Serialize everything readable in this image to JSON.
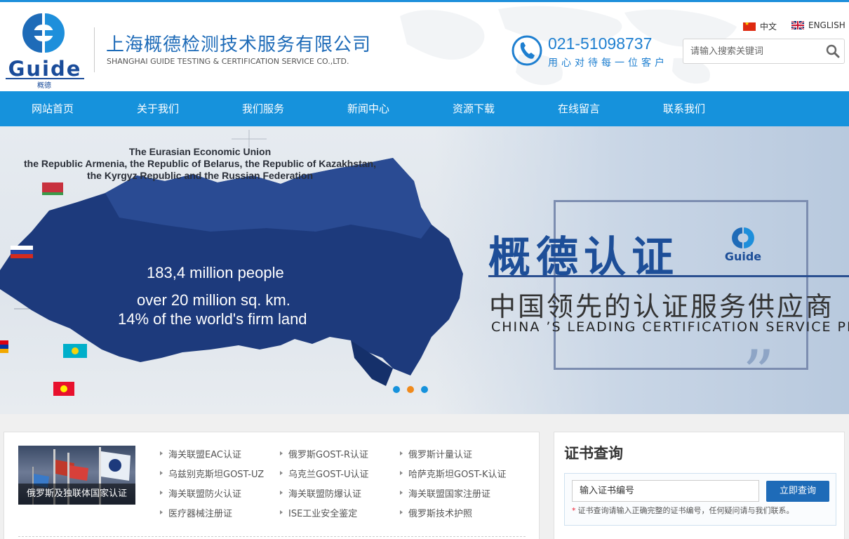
{
  "header": {
    "logo_word": "Guide",
    "logo_sub": "概德",
    "company_cn": "上海概德检测技术服务有限公司",
    "company_en": "SHANGHAI GUIDE TESTING & CERTIFICATION SERVICE CO.,LTD.",
    "phone": "021-51098737",
    "slogan": "用心对待每一位客户",
    "lang_cn": "中文",
    "lang_en": "ENGLISH",
    "search_placeholder": "请输入搜索关键词"
  },
  "nav": {
    "items": [
      "网站首页",
      "关于我们",
      "我们服务",
      "新闻中心",
      "资源下载",
      "在线留言",
      "联系我们"
    ]
  },
  "banner": {
    "eu_line1": "The Eurasian Economic Union",
    "eu_line2": "the Republic Armenia, the Republic of Belarus, the Republic of Kazakhstan,",
    "eu_line3": "the Kyrgyz Republic and the Russian Federation",
    "stat1": "183,4 million people",
    "stat2": "over 20 million sq. km.",
    "stat3": "14% of the world's firm land",
    "cert_title": "概德认证",
    "logo_word": "Guide",
    "cert_sub": "中国领先的认证服务供应商",
    "cert_en": "CHINA ’S LEADING CERTIFICATION SERVICE PROVIDER",
    "quote": "”",
    "active_slide": 2,
    "slide_count": 3
  },
  "certs": {
    "thumb_caption": "俄罗斯及独联体国家认证",
    "links": [
      "海关联盟EAC认证",
      "俄罗斯GOST-R认证",
      "俄罗斯计量认证",
      "乌兹别克斯坦GOST-UZ",
      "乌克兰GOST-U认证",
      "哈萨克斯坦GOST-K认证",
      "海关联盟防火认证",
      "海关联盟防爆认证",
      "海关联盟国家注册证",
      "医疗器械注册证",
      "ISE工业安全鉴定",
      "俄罗斯技术护照"
    ]
  },
  "query": {
    "title": "证书查询",
    "placeholder": "输入证书编号",
    "button": "立即查询",
    "tip": "证书查询请输入正确完整的证书编号，任何疑问请与我们联系。",
    "tip_mark": "*"
  },
  "colors": {
    "brand_blue": "#1692dc",
    "logo_blue": "#1a4c9a",
    "active_dot": "#f08a1c"
  }
}
